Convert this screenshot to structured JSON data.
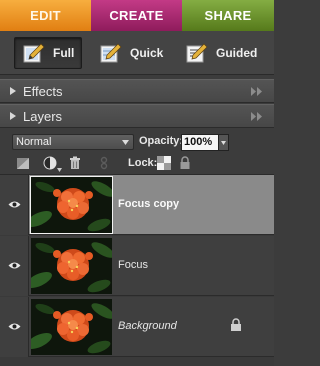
{
  "tabs": {
    "edit": "EDIT",
    "create": "CREATE",
    "share": "SHARE"
  },
  "modes": {
    "full": "Full",
    "quick": "Quick",
    "guided": "Guided",
    "selected": "Full"
  },
  "panels": {
    "effects": "Effects",
    "layers": "Layers"
  },
  "layers_panel": {
    "blend_mode": "Normal",
    "opacity_label": "Opacity:",
    "opacity_value": "100%",
    "lock_label": "Lock:",
    "layers": [
      {
        "name": "Focus copy",
        "selected": true,
        "locked": false,
        "italic": false
      },
      {
        "name": "Focus",
        "selected": false,
        "locked": false,
        "italic": false
      },
      {
        "name": "Background",
        "selected": false,
        "locked": true,
        "italic": true
      }
    ]
  },
  "colors": {
    "edit_tab": "#f0961f",
    "create_tab": "#b02e78",
    "share_tab": "#6d9530",
    "panel_bg": "#3c3c3c",
    "selected_row": "#8a8a8a"
  },
  "icons": [
    "pencil-icon",
    "eye-icon",
    "lock-icon",
    "trash-icon",
    "new-layer-icon",
    "adjustment-layer-icon",
    "link-icon",
    "lock-transparent-icon"
  ]
}
